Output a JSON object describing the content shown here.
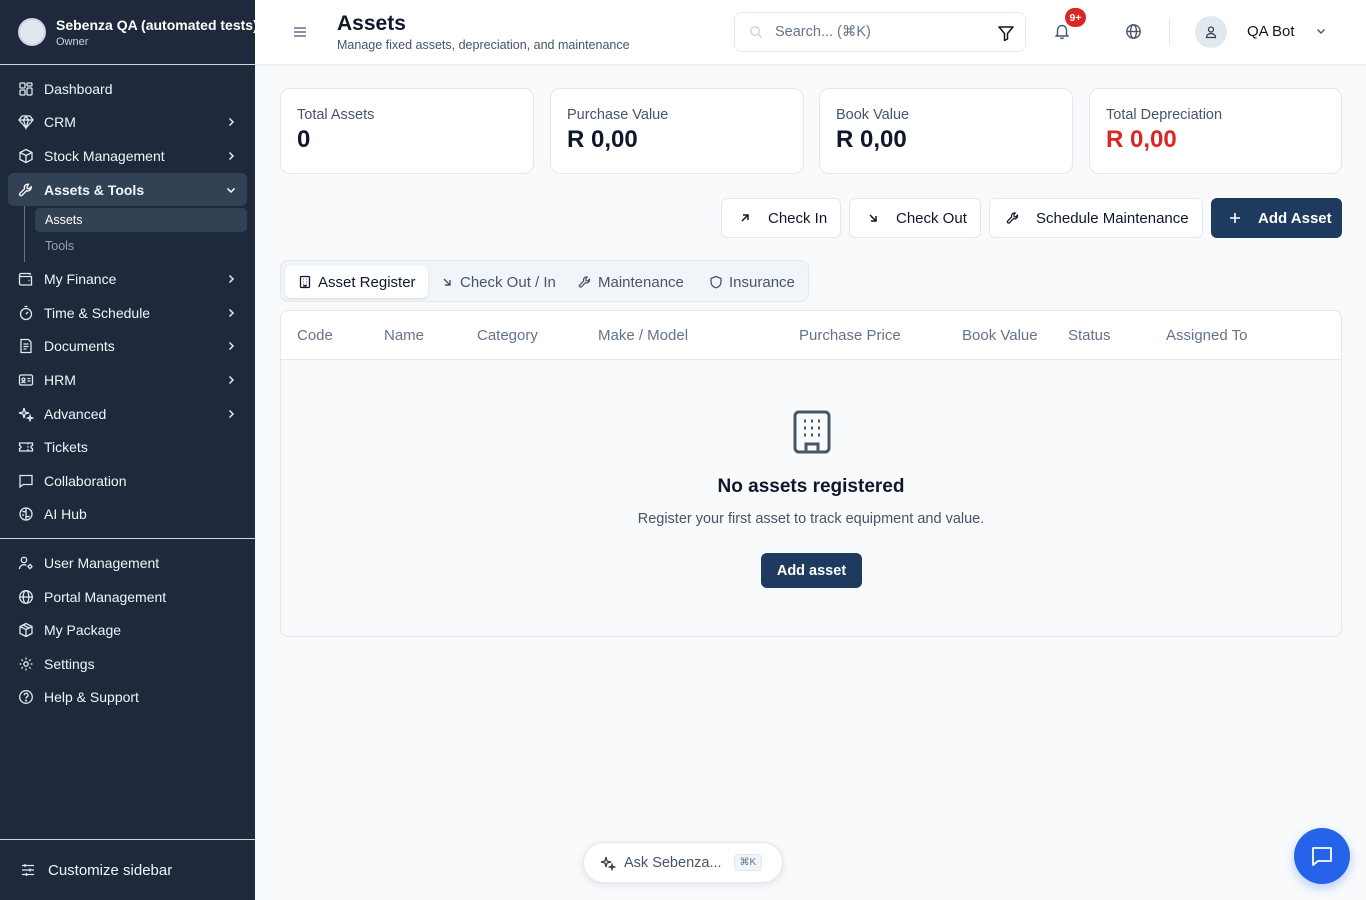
{
  "org": {
    "name": "Sebenza QA (automated tests)",
    "role": "Owner"
  },
  "sidebar": {
    "items": [
      {
        "label": "Dashboard",
        "icon": "dashboard-icon"
      },
      {
        "label": "CRM",
        "icon": "crm-icon"
      },
      {
        "label": "Stock Management",
        "icon": "package-icon"
      },
      {
        "label": "Assets & Tools",
        "icon": "wrench-icon"
      },
      {
        "label": "My Finance",
        "icon": "wallet-icon"
      },
      {
        "label": "Time & Schedule",
        "icon": "timer-icon"
      },
      {
        "label": "Documents",
        "icon": "document-icon"
      },
      {
        "label": "HRM",
        "icon": "id-card-icon"
      },
      {
        "label": "Advanced",
        "icon": "sparkles-icon"
      },
      {
        "label": "Tickets",
        "icon": "ticket-icon"
      },
      {
        "label": "Collaboration",
        "icon": "message-icon"
      },
      {
        "label": "AI Hub",
        "icon": "brain-icon"
      }
    ],
    "subitems": [
      {
        "label": "Assets"
      },
      {
        "label": "Tools"
      }
    ],
    "bottom_items": [
      {
        "label": "User Management",
        "icon": "user-cog-icon"
      },
      {
        "label": "Portal Management",
        "icon": "globe-icon"
      },
      {
        "label": "My Package",
        "icon": "box-icon"
      },
      {
        "label": "Settings",
        "icon": "gear-icon"
      },
      {
        "label": "Help & Support",
        "icon": "help-icon"
      }
    ],
    "footer_label": "Customize sidebar"
  },
  "header": {
    "title": "Assets",
    "subtitle": "Manage fixed assets, depreciation, and maintenance",
    "search_placeholder": "Search... (⌘K)",
    "notifications_badge": "9+",
    "user_name": "QA Bot"
  },
  "stats": [
    {
      "label": "Total Assets",
      "value": "0"
    },
    {
      "label": "Purchase Value",
      "value": "R 0,00"
    },
    {
      "label": "Book Value",
      "value": "R 0,00"
    },
    {
      "label": "Total Depreciation",
      "value": "R 0,00"
    }
  ],
  "actions": {
    "check_in": "Check In",
    "check_out": "Check Out",
    "schedule_maintenance": "Schedule Maintenance",
    "add_asset": "Add Asset"
  },
  "tabs": [
    {
      "label": "Asset Register"
    },
    {
      "label": "Check Out / In"
    },
    {
      "label": "Maintenance"
    },
    {
      "label": "Insurance"
    }
  ],
  "table": {
    "columns": [
      "Code",
      "Name",
      "Category",
      "Make / Model",
      "Purchase Price",
      "Book Value",
      "Status",
      "Assigned To"
    ],
    "empty_title": "No assets registered",
    "empty_text": "Register your first asset to track equipment and value.",
    "empty_button": "Add asset"
  },
  "ask": {
    "label": "Ask Sebenza...",
    "shortcut": "⌘K"
  },
  "colors": {
    "sidebar": "#1e293b",
    "primary": "#1e3a5f",
    "danger": "#dc2626",
    "chat": "#2563eb"
  }
}
